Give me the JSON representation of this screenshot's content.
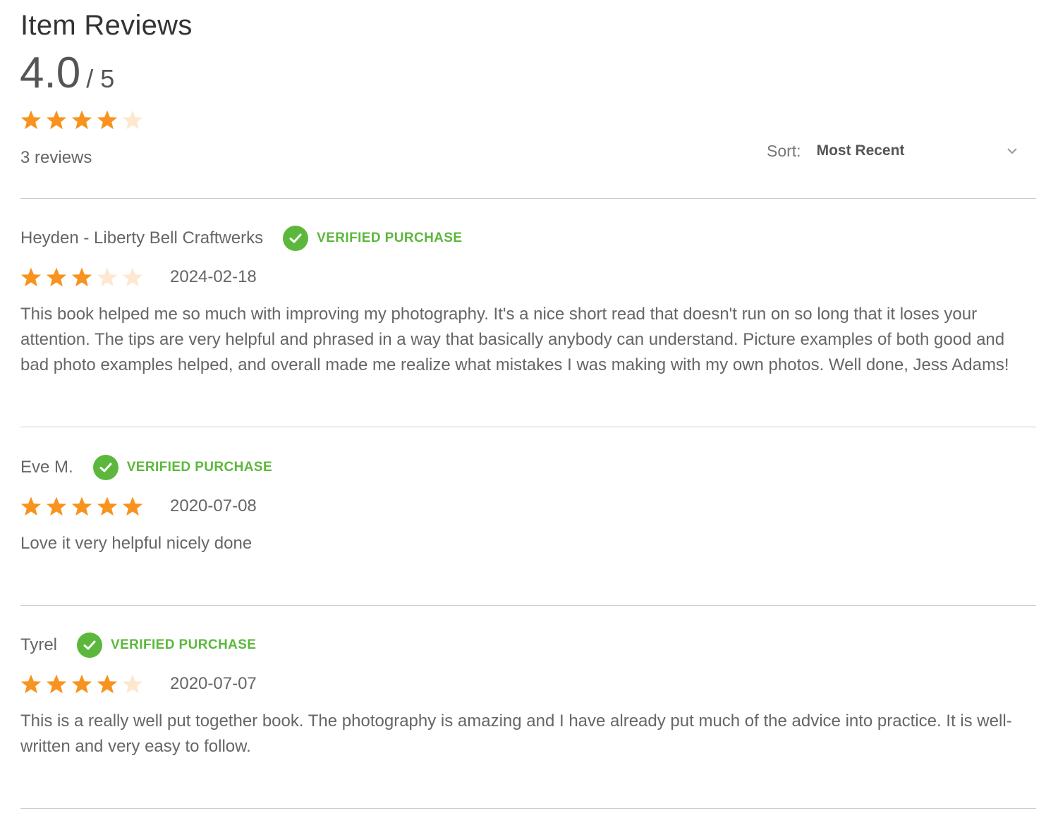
{
  "header": {
    "title": "Item Reviews",
    "average": "4.0",
    "out_of": "/ 5",
    "rating": 4,
    "max_rating": 5,
    "count_text": "3 reviews"
  },
  "sort": {
    "label": "Sort:",
    "value": "Most Recent"
  },
  "colors": {
    "star_filled": "#f7931e",
    "star_empty": "#fde8cf",
    "verified_green": "#5cb83c",
    "divider": "#cccccc"
  },
  "reviews": [
    {
      "name": "Heyden - Liberty Bell Craftwerks",
      "verified": "VERIFIED PURCHASE",
      "rating": 3,
      "date": "2024-02-18",
      "text": "This book helped me so much with improving my photography. It's a nice short read that doesn't run on so long that it loses your attention. The tips are very helpful and phrased in a way that basically anybody can understand. Picture examples of both good and bad photo examples helped, and overall made me realize what mistakes I was making with my own photos. Well done, Jess Adams!"
    },
    {
      "name": "Eve M.",
      "verified": "VERIFIED PURCHASE",
      "rating": 5,
      "date": "2020-07-08",
      "text": "Love it very helpful nicely done"
    },
    {
      "name": "Tyrel",
      "verified": "VERIFIED PURCHASE",
      "rating": 4,
      "date": "2020-07-07",
      "text": "This is a really well put together book. The photography is amazing and I have already put much of the advice into practice. It is well-written and very easy to follow."
    }
  ]
}
